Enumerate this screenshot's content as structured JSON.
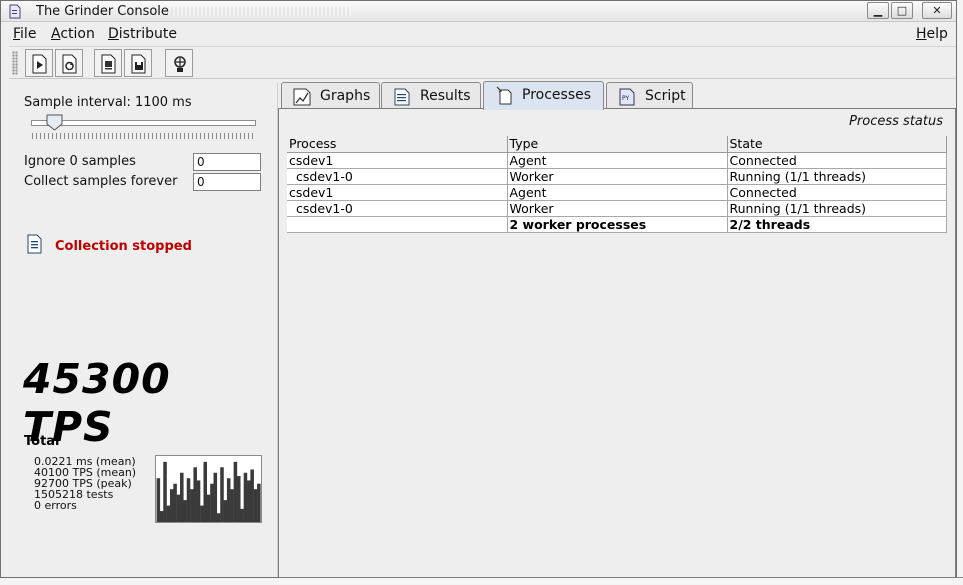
{
  "window": {
    "title": "The Grinder Console"
  },
  "window_controls": {
    "minimize": "▁",
    "maximize": "□",
    "close": "✕"
  },
  "menu": {
    "file": "File",
    "action": "Action",
    "distribute": "Distribute",
    "help": "Help"
  },
  "left": {
    "sample_interval_label": "Sample interval: 1100 ms",
    "ignore_label": "Ignore 0 samples",
    "ignore_value": "0",
    "collect_label": "Collect samples forever",
    "collect_value": "0",
    "status": "Collection stopped",
    "tps": "45300 TPS",
    "total_label": "Total",
    "stats": [
      "0.0221 ms (mean)",
      "40100 TPS (mean)",
      "92700 TPS (peak)",
      "1505218 tests",
      "0 errors"
    ]
  },
  "tabs": [
    {
      "label": "Graphs",
      "icon": "graph-icon"
    },
    {
      "label": "Results",
      "icon": "results-icon"
    },
    {
      "label": "Processes",
      "icon": "processes-icon",
      "active": true
    },
    {
      "label": "Script",
      "icon": "script-icon"
    }
  ],
  "processes": {
    "title": "Process status",
    "headers": [
      "Process",
      "Type",
      "State"
    ],
    "rows": [
      [
        "csdev1",
        "Agent",
        "Connected"
      ],
      [
        "csdev1-0",
        "Worker",
        "Running (1/1 threads)"
      ],
      [
        "csdev1",
        "Agent",
        "Connected"
      ],
      [
        "csdev1-0",
        "Worker",
        "Running (1/1 threads)"
      ]
    ],
    "total": [
      "",
      "2 worker processes",
      "2/2 threads"
    ]
  },
  "sparkline": [
    40,
    10,
    55,
    15,
    30,
    35,
    25,
    45,
    20,
    40,
    30,
    50,
    38,
    15,
    55,
    25,
    35,
    45,
    8,
    50,
    20,
    40,
    30,
    55,
    42,
    12,
    45,
    38,
    48,
    30,
    35
  ]
}
